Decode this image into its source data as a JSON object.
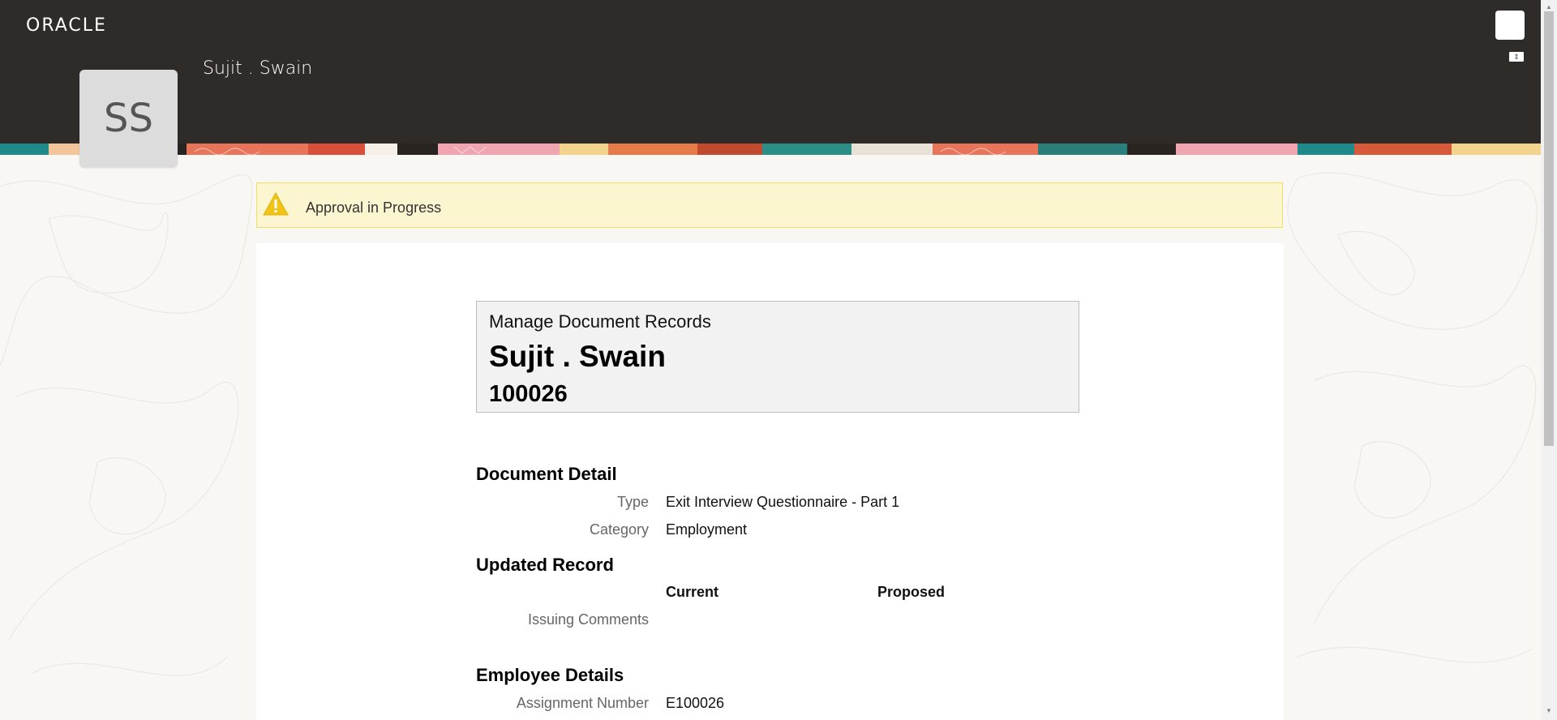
{
  "header": {
    "logo": "ORACLE",
    "person_name": "Sujit . Swain",
    "avatar_initials": "SS",
    "user_button_icon": "user-menu-icon",
    "toggle_icon": "collapse-icon"
  },
  "alert": {
    "icon": "warning-icon",
    "text": "Approval in Progress",
    "color": "#f0c419"
  },
  "document_header": {
    "title": "Manage Document Records",
    "name": "Sujit . Swain",
    "id": "100026"
  },
  "document_detail": {
    "section_title": "Document Detail",
    "type_label": "Type",
    "type_value": "Exit Interview Questionnaire - Part 1",
    "category_label": "Category",
    "category_value": "Employment"
  },
  "updated_record": {
    "section_title": "Updated Record",
    "col_current": "Current",
    "col_proposed": "Proposed",
    "rows": [
      {
        "label": "Issuing Comments",
        "current": "",
        "proposed": ""
      }
    ]
  },
  "employee_details": {
    "section_title": "Employee Details",
    "assignment_label": "Assignment Number",
    "assignment_value": "E100026"
  }
}
